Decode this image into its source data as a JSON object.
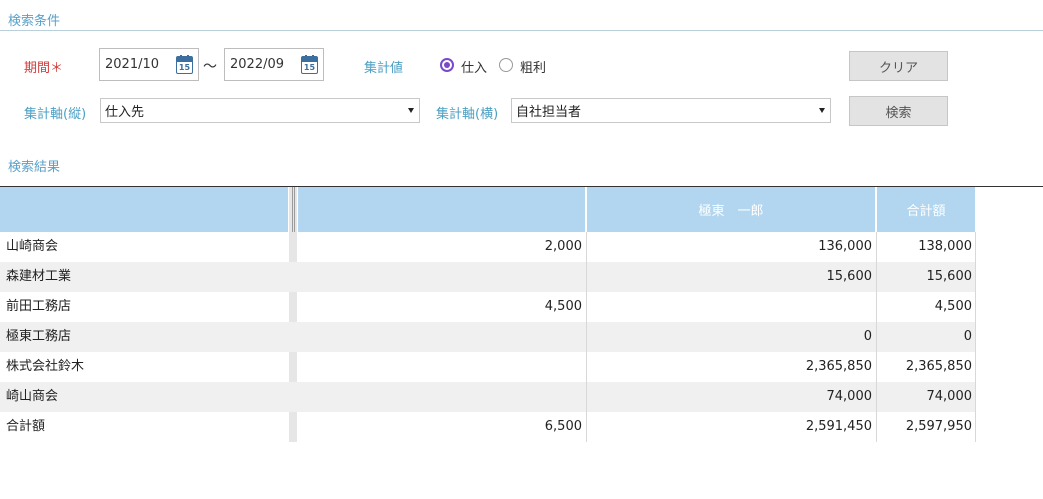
{
  "search": {
    "title": "検索条件",
    "period_label": "期間",
    "required_mark": "＊",
    "date_from": "2021/10",
    "date_to": "2022/09",
    "calendar_day": "15",
    "tilde": "～",
    "agg_value_label": "集計値",
    "radio_options": [
      {
        "label": "仕入",
        "selected": true
      },
      {
        "label": "粗利",
        "selected": false
      }
    ],
    "vertical_axis_label": "集計軸(縦)",
    "vertical_axis_value": "仕入先",
    "horizontal_axis_label": "集計軸(横)",
    "horizontal_axis_value": "自社担当者",
    "clear_button": "クリア",
    "search_button": "検索"
  },
  "results": {
    "title": "検索結果",
    "columns": [
      "",
      "",
      "極東　一郎",
      "合計額"
    ],
    "rows": [
      {
        "name": "山崎商会",
        "c1": "2,000",
        "c2": "136,000",
        "total": "138,000"
      },
      {
        "name": "森建材工業",
        "c1": "",
        "c2": "15,600",
        "total": "15,600"
      },
      {
        "name": "前田工務店",
        "c1": "4,500",
        "c2": "",
        "total": "4,500"
      },
      {
        "name": "極東工務店",
        "c1": "",
        "c2": "0",
        "total": "0"
      },
      {
        "name": "株式会社鈴木",
        "c1": "",
        "c2": "2,365,850",
        "total": "2,365,850"
      },
      {
        "name": "崎山商会",
        "c1": "",
        "c2": "74,000",
        "total": "74,000"
      },
      {
        "name": "合計額",
        "c1": "6,500",
        "c2": "2,591,450",
        "total": "2,597,950"
      }
    ]
  },
  "colors": {
    "accent_blue": "#4ba0c4",
    "required_red": "#d23c3c",
    "radio_purple": "#7a48c8",
    "header_bg": "#b2d6ef"
  }
}
